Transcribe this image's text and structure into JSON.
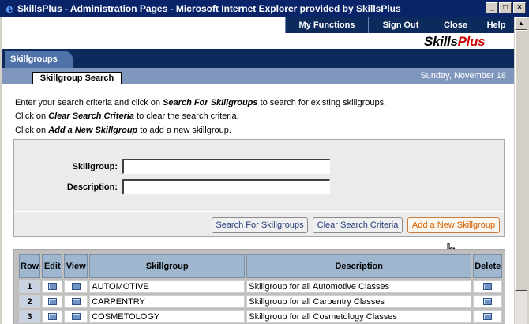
{
  "window": {
    "title": "SkillsPlus - Administration Pages - Microsoft Internet Explorer provided by SkillsPlus",
    "icon": "internet-explorer-icon",
    "controls": [
      "_",
      "□",
      "×"
    ]
  },
  "topnav": {
    "items": [
      "My Functions",
      "Sign Out",
      "Close",
      "Help"
    ]
  },
  "brand": {
    "part1": "Skills",
    "part2": "Plus",
    "accent_color": "#cc0000"
  },
  "tabs": {
    "main": "Skillgroups",
    "sub": "Skillgroup Search"
  },
  "date": "Sunday, November 18",
  "instructions": [
    {
      "pre": "Enter your search criteria and click on ",
      "em": "Search For Skillgroups",
      "post": " to search for existing skillgroups."
    },
    {
      "pre": "Click on ",
      "em": "Clear Search Criteria",
      "post": " to clear the search criteria."
    },
    {
      "pre": "Click on ",
      "em": "Add a New Skillgroup",
      "post": " to add a new skillgroup."
    }
  ],
  "search": {
    "skillgroup_label": "Skillgroup:",
    "skillgroup_value": "",
    "description_label": "Description:",
    "description_value": "",
    "buttons": {
      "search": "Search For Skillgroups",
      "clear": "Clear Search Criteria",
      "add": "Add a New Skillgroup"
    }
  },
  "results": {
    "columns": [
      "Row",
      "Edit",
      "View",
      "Skillgroup",
      "Description",
      "Delete"
    ],
    "rows": [
      {
        "row": "1",
        "skillgroup": "AUTOMOTIVE",
        "description": "Skillgroup for all Automotive Classes"
      },
      {
        "row": "2",
        "skillgroup": "CARPENTRY",
        "description": "Skillgroup for all Carpentry Classes"
      },
      {
        "row": "3",
        "skillgroup": "COSMETOLOGY",
        "description": "Skillgroup for all Cosmetology Classes"
      }
    ]
  },
  "colors": {
    "titlebar": "#0a246a",
    "nav": "#0d2a5c",
    "header_cell": "#9fb6cf",
    "active_button_text": "#d65f00"
  }
}
